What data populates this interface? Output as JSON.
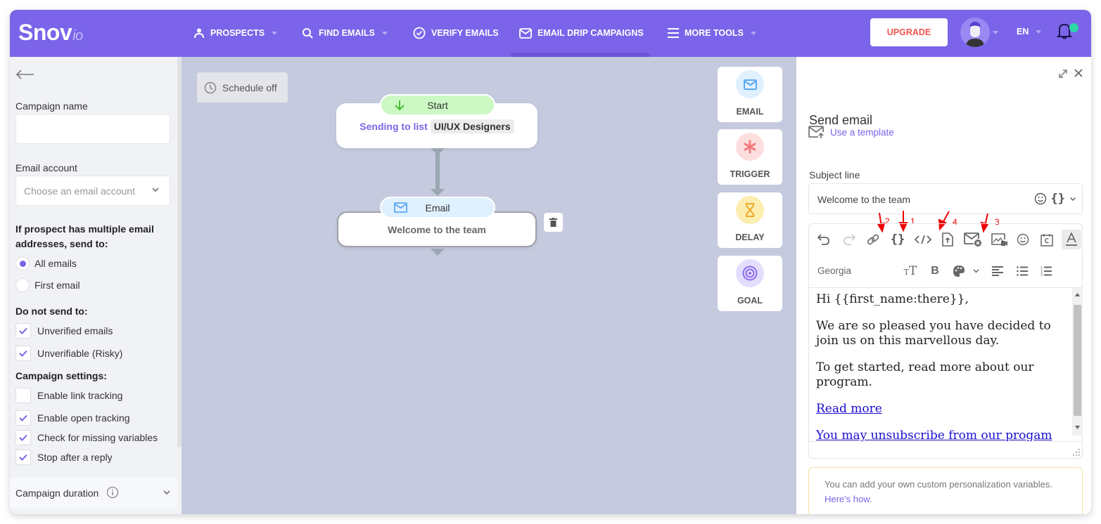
{
  "header": {
    "logo_main": "Snov",
    "logo_suffix": "io",
    "nav": [
      {
        "label": "PROSPECTS",
        "icon": "person-icon",
        "has_caret": true
      },
      {
        "label": "FIND EMAILS",
        "icon": "search-icon",
        "has_caret": true
      },
      {
        "label": "VERIFY EMAILS",
        "icon": "check-circle-icon",
        "has_caret": false
      },
      {
        "label": "EMAIL DRIP CAMPAIGNS",
        "icon": "envelope-icon",
        "has_caret": false,
        "active": true
      },
      {
        "label": "MORE TOOLS",
        "icon": "menu-icon",
        "has_caret": true
      }
    ],
    "upgrade_label": "UPGRADE",
    "language": "EN",
    "colors": {
      "brand": "#7b64e9",
      "upgrade_text": "#f0544f",
      "notification_dot": "#2ed8a8"
    }
  },
  "left_panel": {
    "campaign_name_label": "Campaign name",
    "campaign_name_value": "",
    "email_account_label": "Email account",
    "email_account_placeholder": "Choose an email account",
    "multiple_addresses_heading": "If prospect has multiple email addresses, send to:",
    "send_to_options": [
      {
        "label": "All emails",
        "selected": true
      },
      {
        "label": "First email",
        "selected": false
      }
    ],
    "do_not_send_heading": "Do not send to:",
    "do_not_send_options": [
      {
        "label": "Unverified emails",
        "checked": true
      },
      {
        "label": "Unverifiable (Risky)",
        "checked": true
      }
    ],
    "settings_heading": "Campaign settings:",
    "settings_options": [
      {
        "label": "Enable link tracking",
        "checked": false
      },
      {
        "label": "Enable open tracking",
        "checked": true
      },
      {
        "label": "Check for missing variables",
        "checked": true
      },
      {
        "label": "Stop after a reply",
        "checked": true
      }
    ],
    "duration_label": "Campaign duration"
  },
  "canvas": {
    "schedule_label": "Schedule off",
    "start_node": {
      "pill_label": "Start",
      "sending_text": "Sending to list",
      "list_name": "UI/UX Designers"
    },
    "email_node": {
      "pill_label": "Email",
      "title": "Welcome to the team"
    },
    "tools": [
      {
        "label": "EMAIL",
        "icon": "envelope-icon",
        "bg": "#dff0ff",
        "fg": "#5aa9f5"
      },
      {
        "label": "TRIGGER",
        "icon": "asterisk-icon",
        "bg": "#fddede",
        "fg": "#f47a7a"
      },
      {
        "label": "DELAY",
        "icon": "hourglass-icon",
        "bg": "#fbeeb0",
        "fg": "#f0a929"
      },
      {
        "label": "GOAL",
        "icon": "target-icon",
        "bg": "#e4defd",
        "fg": "#8d6cf0"
      }
    ]
  },
  "right_panel": {
    "title": "Send email",
    "use_template_label": "Use a template",
    "subject_label": "Subject line",
    "subject_value": "Welcome to the team",
    "editor_font": "Georgia",
    "toolbar_row1": [
      "undo-icon",
      "redo-icon",
      "link-icon",
      "variable-braces-icon",
      "code-icon",
      "attach-file-icon",
      "unsubscribe-icon",
      "video-image-icon",
      "emoji-icon",
      "calendar-icon",
      "text-color-icon"
    ],
    "toolbar_row2": [
      "font-size-icon",
      "bold-icon",
      "palette-icon",
      "align-left-icon",
      "bullet-list-icon",
      "numbered-list-icon"
    ],
    "annotations": [
      {
        "target": "link-icon",
        "number": "2"
      },
      {
        "target": "variable-braces-icon",
        "number": "1"
      },
      {
        "target": "code-icon",
        "number": "4"
      },
      {
        "target": "unsubscribe-icon",
        "number": "3"
      }
    ],
    "body": {
      "greeting": "Hi {{first_name:there}},",
      "paragraph1": "We are so pleased you have decided to join us on this marvellous day.",
      "paragraph2": "To get started, read more about our program.",
      "link1": "Read more",
      "link2": "You may unsubscribe from our progam"
    },
    "info_text": "You can add your own custom personalization variables.",
    "info_link": "Here's how",
    "info_suffix": "."
  }
}
